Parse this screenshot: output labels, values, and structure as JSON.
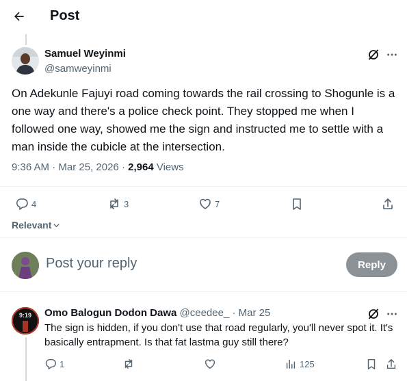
{
  "header": {
    "title": "Post"
  },
  "tweet": {
    "author_name": "Samuel Weyinmi",
    "author_handle": "@samweyinmi",
    "text": "On Adekunle Fajuyi road coming towards the rail crossing to Shogunle is a one way and there's a police check point. They stopped me when I followed one way, showed me the sign and instructed me to settle with a man inside the cubicle at the intersection.",
    "time": "9:36 AM",
    "date": "Mar 25, 2026",
    "separator": "·",
    "views_count": "2,964",
    "views_label": "Views",
    "replies": "4",
    "reposts": "3",
    "likes": "7"
  },
  "sort": {
    "label": "Relevant"
  },
  "composer": {
    "placeholder": "Post your reply",
    "button": "Reply"
  },
  "reply": {
    "author_name": "Omo Balogun Dodon Dawa",
    "author_handle": "@ceedee_",
    "separator": "·",
    "date": "Mar 25",
    "avatar_text": "9:19",
    "text": "The sign is hidden, if you don't use that road regularly, you'll never spot it. It's basically entrapment. Is that fat lastma guy still there?",
    "replies": "1",
    "views": "125"
  },
  "icons": {
    "back": "arrow-left-icon",
    "grok": "grok-icon",
    "more": "more-horizontal-icon",
    "reply": "reply-bubble-icon",
    "repost": "repost-icon",
    "like": "heart-icon",
    "bookmark": "bookmark-icon",
    "share": "share-icon",
    "views": "views-bar-chart-icon",
    "chevron": "chevron-down-icon"
  },
  "colors": {
    "text": "#0f1419",
    "secondary": "#536471",
    "divider": "#eff3f4",
    "reply_button": "#8b9297"
  }
}
